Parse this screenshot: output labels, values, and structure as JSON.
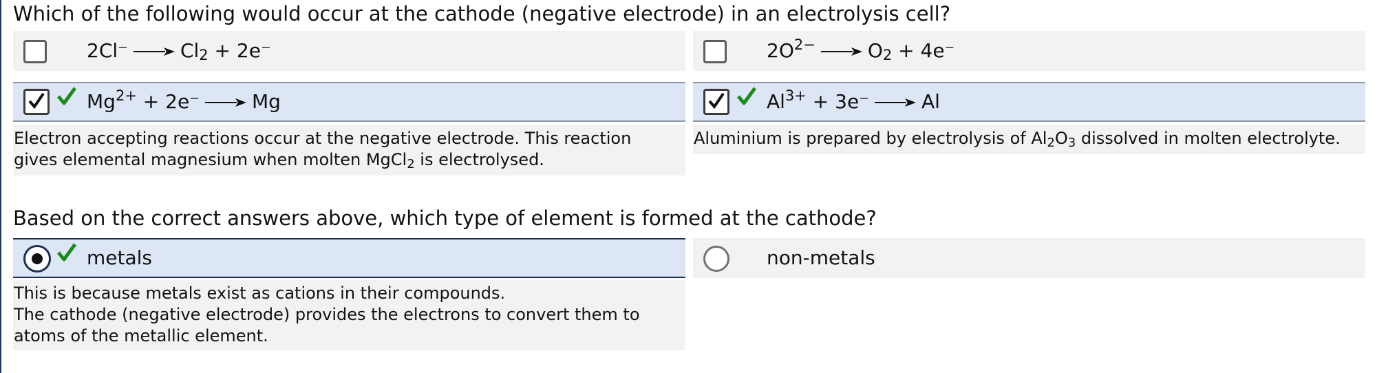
{
  "question1": {
    "text": "Which of the following would occur at the cathode (negative electrode) in an electrolysis cell?",
    "options": [
      {
        "id": "a",
        "checked": false,
        "correct": false,
        "lhs": "2Cl⁻",
        "rhs_species": "Cl",
        "rhs_sub": "2",
        "rhs_rest": " + 2e⁻"
      },
      {
        "id": "b",
        "checked": false,
        "correct": false,
        "lhs_base": "2O",
        "lhs_sup": "2−",
        "rhs_species": "O",
        "rhs_sub": "2",
        "rhs_rest": " + 4e⁻"
      },
      {
        "id": "c",
        "checked": true,
        "correct": true,
        "lhs_base": "Mg",
        "lhs_sup": "2+",
        "lhs_rest": " + 2e⁻",
        "rhs": "Mg",
        "feedback_line1": "Electron accepting reactions occur at the negative electrode.  This reaction",
        "feedback_line2_pre": "gives elemental magnesium when molten MgCl",
        "feedback_line2_sub": "2",
        "feedback_line2_post": " is electrolysed."
      },
      {
        "id": "d",
        "checked": true,
        "correct": true,
        "lhs_base": "Al",
        "lhs_sup": "3+",
        "lhs_rest": " + 3e⁻",
        "rhs": "Al",
        "feedback_pre": "Aluminium is prepared by electrolysis of Al",
        "feedback_sub1": "2",
        "feedback_mid": "O",
        "feedback_sub2": "3",
        "feedback_post": " dissolved in molten electrolyte."
      }
    ]
  },
  "question2": {
    "text": "Based on the correct answers above, which type of element is formed at the cathode?",
    "options": [
      {
        "id": "metals",
        "label": "metals",
        "selected": true,
        "correct": true
      },
      {
        "id": "non-metals",
        "label": "non-metals",
        "selected": false,
        "correct": false
      }
    ],
    "feedback_lines": [
      "This is because metals exist as cations in their compounds.",
      "The cathode (negative electrode) provides the electrons to convert them to",
      "atoms of the metallic element."
    ]
  },
  "colors": {
    "selected_bg": "#dce6f5",
    "option_bg": "#f2f2f2",
    "tick": "#1a8a1a",
    "rule": "#1c3a5e"
  },
  "icons": {
    "tick": "check-mark-icon",
    "arrow": "reaction-arrow-icon"
  }
}
